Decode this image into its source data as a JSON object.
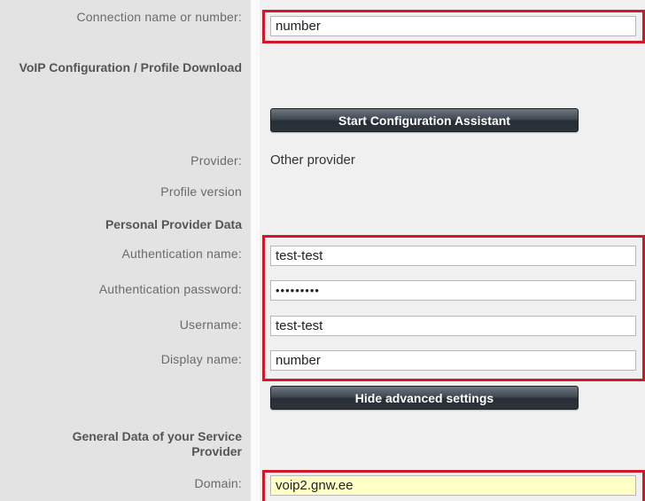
{
  "connection": {
    "label": "Connection name or number:",
    "value": "number"
  },
  "voip": {
    "heading": "VoIP Configuration / Profile Download",
    "assistant_button": "Start Configuration Assistant",
    "provider_label": "Provider:",
    "provider_value": "Other provider",
    "profile_label": "Profile version"
  },
  "personal": {
    "heading": "Personal Provider Data",
    "auth_name_label": "Authentication name:",
    "auth_name_value": "test-test",
    "auth_password_label": "Authentication password:",
    "auth_password_value": "•••••••••",
    "username_label": "Username:",
    "username_value": "test-test",
    "display_label": "Display name:",
    "display_value": "number"
  },
  "advanced": {
    "hide_button": "Hide advanced settings"
  },
  "general": {
    "heading": "General Data of your Service Provider",
    "domain_label": "Domain:",
    "domain_value": "voip2.gnw.ee"
  },
  "colors": {
    "highlight": "#d1182a",
    "label_bg": "#e3e3e3",
    "domain_field_bg": "#ffffc6"
  }
}
